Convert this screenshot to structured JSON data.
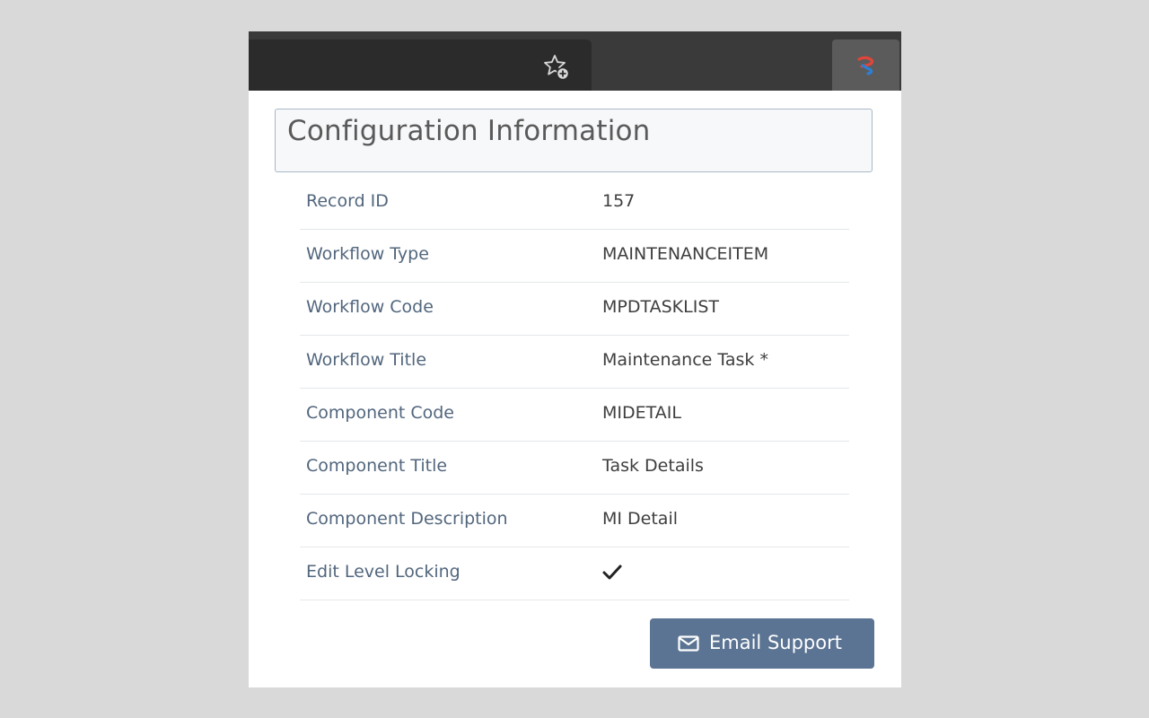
{
  "browser": {
    "bookmark_icon": "star-plus-icon",
    "extension_icon": "extension-logo-icon"
  },
  "panel": {
    "title": "Configuration Information",
    "rows": [
      {
        "label": "Record ID",
        "value": "157"
      },
      {
        "label": "Workflow Type",
        "value": "MAINTENANCEITEM"
      },
      {
        "label": "Workflow Code",
        "value": "MPDTASKLIST"
      },
      {
        "label": "Workflow Title",
        "value": "Maintenance Task *"
      },
      {
        "label": "Component Code",
        "value": "MIDETAIL"
      },
      {
        "label": "Component Title",
        "value": "Task Details"
      },
      {
        "label": "Component Description",
        "value": "MI Detail"
      },
      {
        "label": "Edit Level Locking",
        "value": null,
        "checked": true
      }
    ],
    "email_button": {
      "label": "Email Support",
      "icon": "envelope-icon"
    }
  },
  "colors": {
    "label_text": "#52667d",
    "button_bg": "#5b7493",
    "header_border": "#a9b8c8",
    "browser_bar": "#3a3a3a"
  }
}
